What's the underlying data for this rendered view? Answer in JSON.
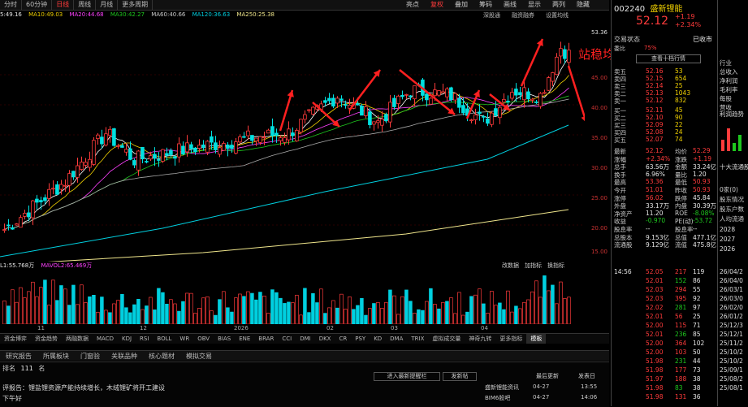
{
  "toolbar": {
    "tabs": [
      "分时",
      "60分钟",
      "日线",
      "周线",
      "月线",
      "更多周期"
    ],
    "right": [
      "亮点",
      "复权",
      "叠加",
      "筹码",
      "画线",
      "显示",
      "两列",
      "隐藏"
    ],
    "sub": [
      "深股通",
      "融资融券",
      "设置均线"
    ]
  },
  "ma": {
    "m0": "5:49.16",
    "m10": "MA10:49.03",
    "m20": "MA20:44.68",
    "m30": "MA30:42.27",
    "m60": "MA60:40.66",
    "m120": "MA120:36.63",
    "m250": "MA250:25.38"
  },
  "price_axis": {
    "top": "53.36",
    "ticks": [
      "45.00",
      "40.00",
      "35.00",
      "30.00",
      "25.00",
      "20.00",
      "15.00"
    ]
  },
  "annotation": "站稳均线上方，持续上涨势头",
  "vol_header": {
    "vol": "L1:55.768万",
    "mavol": "MAVOL2:65.469万",
    "links": [
      "改数据",
      "加指标",
      "换指标"
    ]
  },
  "dates": [
    "11",
    "12",
    "2026",
    "02",
    "03",
    "04"
  ],
  "indicator_tabs": [
    "资金博弈",
    "资金趋势",
    "两融数据",
    "MACD",
    "KDJ",
    "RSI",
    "BOLL",
    "WR",
    "OBV",
    "BIAS",
    "ENE",
    "BRAR",
    "CCI",
    "DMI",
    "DKX",
    "CR",
    "PSY",
    "KD",
    "DMA",
    "TRIX",
    "虚拟成交量",
    "神奇九转",
    "更多指标",
    "模板"
  ],
  "news_tabs": [
    "研究报告",
    "所属板块",
    "门窗验",
    "关联品种",
    "核心题材",
    "模拟交易"
  ],
  "rank": {
    "label": "排名",
    "value": "111",
    "suffix": "名"
  },
  "bottom": {
    "btn1": "进入最新提醒栏",
    "btn2": "发新帖",
    "sort": "最后更新",
    "dir": "发表日",
    "news": [
      {
        "text": "评报告：锂盐锂资源产能持续增长，木绒锂矿将开工建设",
        "src": "盛新锂能资讯",
        "date": "04-27",
        "time": "13:55"
      },
      {
        "text": "下午好",
        "src": "BIM6股吧",
        "date": "04-27",
        "time": "14:06"
      }
    ]
  },
  "quote": {
    "code": "002240",
    "name": "盛新锂能",
    "price": "52.12",
    "change": "+1.19",
    "pct": "+2.34%",
    "status": "交易状态",
    "closed": "已收市",
    "diff_label": "委比",
    "diff_pct": "75%",
    "diff_hint": "查看十档行情",
    "asks": [
      {
        "l": "卖五",
        "p": "52.16",
        "v": "53"
      },
      {
        "l": "卖四",
        "p": "52.15",
        "v": "654"
      },
      {
        "l": "卖三",
        "p": "52.14",
        "v": "25"
      },
      {
        "l": "卖二",
        "p": "52.13",
        "v": "1043"
      },
      {
        "l": "卖一",
        "p": "52.12",
        "v": "832"
      }
    ],
    "bids": [
      {
        "l": "买一",
        "p": "52.11",
        "v": "45"
      },
      {
        "l": "买二",
        "p": "52.10",
        "v": "90"
      },
      {
        "l": "买三",
        "p": "52.09",
        "v": "22"
      },
      {
        "l": "买四",
        "p": "52.08",
        "v": "24"
      },
      {
        "l": "买五",
        "p": "52.07",
        "v": "74"
      }
    ],
    "stats": [
      {
        "l1": "最新",
        "v1": "52.12",
        "l2": "均价",
        "v2": "52.29"
      },
      {
        "l1": "涨幅",
        "v1": "+2.34%",
        "l2": "涨跌",
        "v2": "+1.19"
      },
      {
        "l1": "总手",
        "v1": "63.56万",
        "l2": "金额",
        "v2": "33.24亿"
      },
      {
        "l1": "换手",
        "v1": "6.96%",
        "l2": "量比",
        "v2": "1.20"
      },
      {
        "l1": "最高",
        "v1": "53.36",
        "l2": "最低",
        "v2": "50.93"
      },
      {
        "l1": "今开",
        "v1": "51.01",
        "l2": "昨收",
        "v2": "50.93"
      },
      {
        "l1": "涨停",
        "v1": "56.02",
        "l2": "跌停",
        "v2": "45.84"
      },
      {
        "l1": "外盘",
        "v1": "33.17万",
        "l2": "内盘",
        "v2": "30.39万"
      },
      {
        "l1": "净资产",
        "v1": "11.20",
        "l2": "ROE",
        "v2": "-8.08%"
      },
      {
        "l1": "收益",
        "v1": "-0.970",
        "l2": "PE(动)",
        "v2": "-53.72"
      },
      {
        "l1": "股息率",
        "v1": "--",
        "l2": "股息率",
        "v2": "--"
      },
      {
        "l1": "总股本",
        "v1": "9.153亿",
        "l2": "总值",
        "v2": "477.1亿"
      },
      {
        "l1": "流通股",
        "v1": "9.129亿",
        "l2": "流值",
        "v2": "475.8亿"
      }
    ],
    "ticks": [
      {
        "t": "14:56",
        "p": "52.05",
        "v": "217",
        "n": "119"
      },
      {
        "t": "",
        "p": "52.01",
        "v": "152",
        "n": "86"
      },
      {
        "t": "",
        "p": "52.03",
        "v": "294",
        "n": "55"
      },
      {
        "t": "",
        "p": "52.03",
        "v": "395",
        "n": "92"
      },
      {
        "t": "",
        "p": "52.02",
        "v": "281",
        "n": "97"
      },
      {
        "t": "",
        "p": "52.01",
        "v": "56",
        "n": "25"
      },
      {
        "t": "",
        "p": "52.00",
        "v": "115",
        "n": "71"
      },
      {
        "t": "",
        "p": "52.01",
        "v": "236",
        "n": "85"
      },
      {
        "t": "",
        "p": "52.00",
        "v": "364",
        "n": "102"
      },
      {
        "t": "",
        "p": "52.00",
        "v": "103",
        "n": "50"
      },
      {
        "t": "",
        "p": "51.98",
        "v": "231",
        "n": "44"
      },
      {
        "t": "",
        "p": "51.98",
        "v": "177",
        "n": "73"
      },
      {
        "t": "",
        "p": "51.97",
        "v": "188",
        "n": "38"
      },
      {
        "t": "",
        "p": "51.98",
        "v": "83",
        "n": "38"
      },
      {
        "t": "",
        "p": "51.98",
        "v": "131",
        "n": "36"
      }
    ]
  },
  "far_right": {
    "items": [
      "行业",
      "总收入",
      "净利润",
      "毛利率",
      "每股",
      "营收"
    ],
    "profit_title": "利润趋势",
    "top10": "十大流通股",
    "rows": [
      "0家(0)",
      "股东情况",
      "股东户数",
      "人均流通"
    ],
    "years": [
      "2028",
      "2027",
      "2026"
    ],
    "dates": [
      "26/04/2",
      "26/04/0",
      "26/03/1",
      "26/03/0",
      "26/02/0",
      "26/01/2",
      "25/12/3",
      "25/12/1",
      "25/11/2",
      "25/10/2",
      "25/10/2",
      "25/09/1",
      "25/08/2",
      "25/08/1"
    ]
  }
}
